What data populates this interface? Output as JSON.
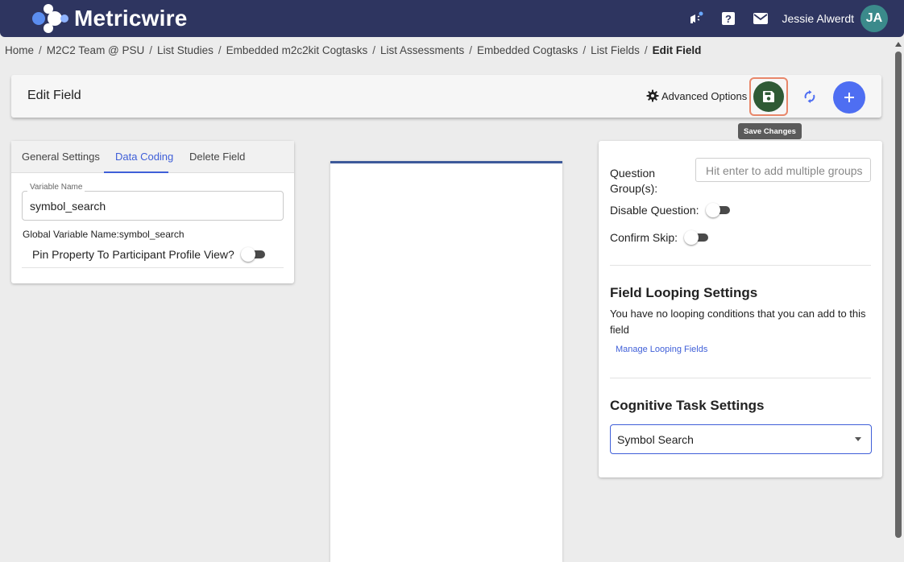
{
  "app": {
    "brand": "Metricwire",
    "user_name": "Jessie Alwerdt",
    "user_initials": "JA"
  },
  "nav": {
    "icons": [
      "megaphone-icon",
      "help-icon",
      "mail-icon"
    ]
  },
  "breadcrumb": {
    "items": [
      "Home",
      "M2C2 Team @ PSU",
      "List Studies",
      "Embedded m2c2kit Cogtasks",
      "List Assessments",
      "Embedded Cogtasks",
      "List Fields"
    ],
    "current": "Edit Field",
    "separator": "/"
  },
  "header": {
    "title": "Edit Field",
    "advanced_options_label": "Advanced Options",
    "save_tooltip": "Save Changes"
  },
  "left_panel": {
    "tabs": [
      "General Settings",
      "Data Coding",
      "Delete Field"
    ],
    "active_tab": "Data Coding",
    "variable_name_label": "Variable Name",
    "variable_name_value": "symbol_search",
    "global_variable_text": "Global Variable Name:symbol_search",
    "pin_property_label": "Pin Property To Participant Profile View?",
    "pin_property_on": false
  },
  "right_panel": {
    "question_groups_label": "Question Group(s):",
    "question_groups_placeholder": "Hit enter to add multiple groups",
    "disable_question_label": "Disable Question:",
    "disable_question_on": false,
    "confirm_skip_label": "Confirm Skip:",
    "confirm_skip_on": false,
    "looping_title": "Field Looping Settings",
    "looping_text": "You have no looping conditions that you can add to this field",
    "manage_looping_link": "Manage Looping Fields",
    "cognitive_title": "Cognitive Task Settings",
    "cognitive_task_value": "Symbol Search"
  },
  "colors": {
    "topbar": "#2e3560",
    "accent": "#3f5fd8",
    "save_button": "#2f5a35",
    "add_button": "#4e6ef2",
    "avatar": "#3b8a8b",
    "highlight_border": "#e8876a"
  }
}
